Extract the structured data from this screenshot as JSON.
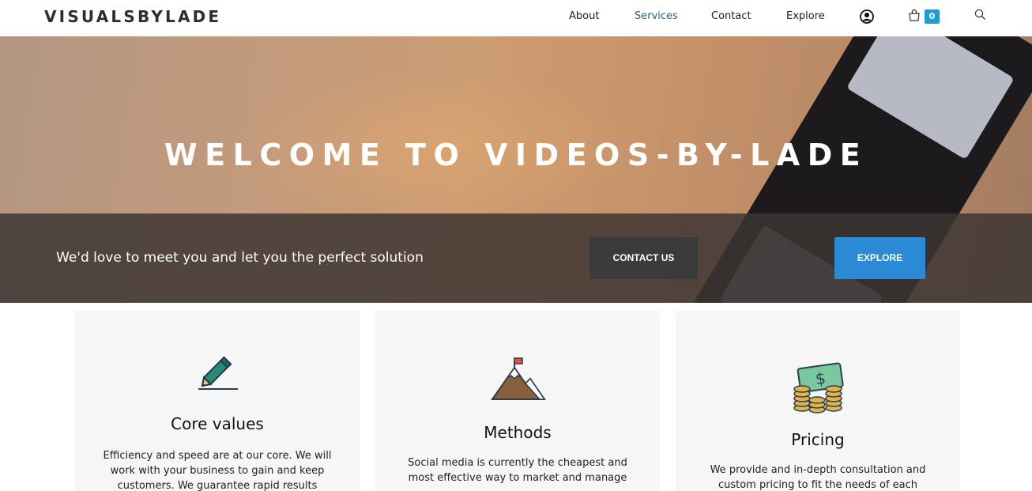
{
  "header": {
    "logo": "VISUALSBYLADE",
    "nav": [
      "About",
      "Services",
      "Contact",
      "Explore"
    ],
    "cart_count": "0",
    "icons": [
      "user-icon",
      "shopping-bag-icon",
      "search-icon"
    ]
  },
  "hero": {
    "title": "WELCOME TO VIDEOS-BY-LADE",
    "tagline": "We'd love to meet you and let you the perfect solution",
    "contact_button": "CONTACT US",
    "explore_button": "EXPLORE"
  },
  "cards": [
    {
      "icon": "pencil-icon",
      "title": "Core values",
      "text": "Efficiency and speed are at our core. We will work with your business to gain and keep customers. We guarantee rapid results"
    },
    {
      "icon": "mountain-flag-icon",
      "title": "Methods",
      "text": "Social media is currently the cheapest and most effective way to market and manage"
    },
    {
      "icon": "money-coins-icon",
      "title": "Pricing",
      "text": "We provide and in-depth consultation and custom pricing to fit the needs of each"
    }
  ],
  "colors": {
    "accent": "#2a8ad6",
    "nav_active": "#2b5d7e",
    "cart_badge": "#1f9bd7",
    "band": "#3c3432"
  }
}
